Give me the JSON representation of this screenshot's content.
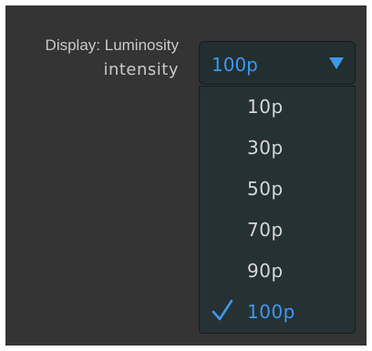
{
  "setting": {
    "label_line1": "Display: Luminosity",
    "label_line2": "intensity",
    "current_value": "100p"
  },
  "dropdown": {
    "options": [
      {
        "label": "10p",
        "selected": false
      },
      {
        "label": "30p",
        "selected": false
      },
      {
        "label": "50p",
        "selected": false
      },
      {
        "label": "70p",
        "selected": false
      },
      {
        "label": "90p",
        "selected": false
      },
      {
        "label": "100p",
        "selected": true
      }
    ]
  },
  "colors": {
    "panel_background": "#343434",
    "control_background": "#232e31",
    "accent_blue": "#3d98ec",
    "option_text": "#d6d6d6",
    "label_text": "#c9c9c9"
  },
  "icons": {
    "dropdown_arrow": "triangle-down-icon",
    "selected_marker": "checkmark-icon"
  }
}
